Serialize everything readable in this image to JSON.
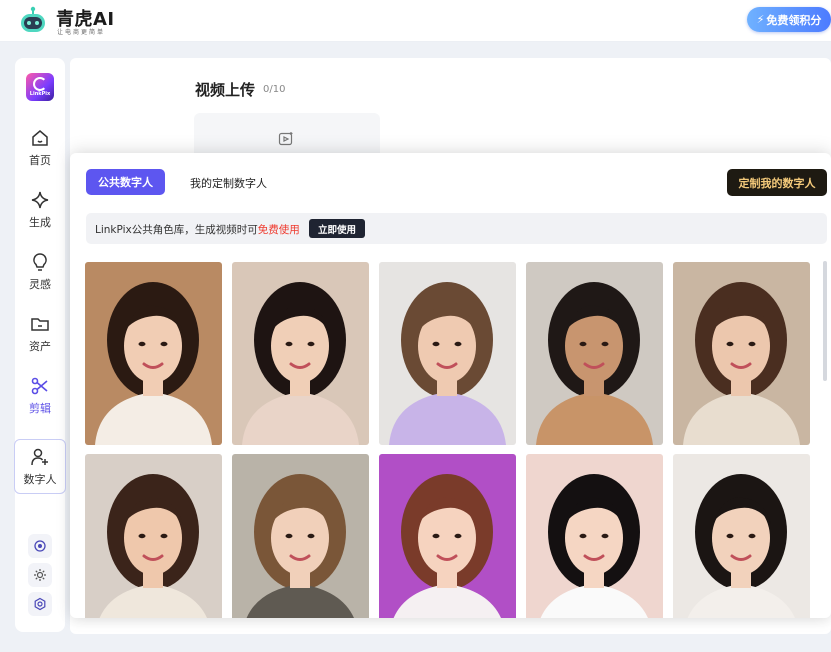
{
  "header": {
    "brand_name": "青虎AI",
    "brand_tagline": "让电商更简单",
    "credits_button": "免费领积分"
  },
  "sidebar": {
    "logo_text": "LinkPix",
    "items": [
      {
        "label": "首页",
        "icon": "home-icon"
      },
      {
        "label": "生成",
        "icon": "sparkle-icon"
      },
      {
        "label": "灵感",
        "icon": "lightbulb-icon"
      },
      {
        "label": "资产",
        "icon": "folder-icon"
      },
      {
        "label": "剪辑",
        "icon": "scissors-icon"
      },
      {
        "label": "数字人",
        "icon": "user-plus-icon"
      }
    ],
    "bottom_buttons": [
      "target-icon",
      "sun-icon",
      "settings-icon"
    ]
  },
  "upload": {
    "title": "视频上传",
    "count": "0/10"
  },
  "panel": {
    "tabs": [
      "公共数字人",
      "我的定制数字人"
    ],
    "active_tab": "公共数字人",
    "custom_button": "定制我的数字人",
    "notice": {
      "text_before": "LinkPix公共角色库，生成视频时可",
      "highlight": "免费使用",
      "button": "立即使用"
    },
    "avatars": [
      {
        "name": "avatar-1",
        "bg": "#b98a63",
        "hair": "#2b1a12",
        "skin": "#f1cdb4",
        "cloth": "#f4ede5"
      },
      {
        "name": "avatar-2",
        "bg": "#d9c7b8",
        "hair": "#1e1412",
        "skin": "#f0cfb7",
        "cloth": "#e9d4c8"
      },
      {
        "name": "avatar-3",
        "bg": "#e6e4e2",
        "hair": "#6a4a34",
        "skin": "#efcab1",
        "cloth": "#c8b4e8"
      },
      {
        "name": "avatar-4",
        "bg": "#cfc9c2",
        "hair": "#1f1816",
        "skin": "#c8956f",
        "cloth": "#c89468"
      },
      {
        "name": "avatar-5",
        "bg": "#c9b6a2",
        "hair": "#4a2e20",
        "skin": "#ecc7ad",
        "cloth": "#e8ddcf"
      },
      {
        "name": "avatar-6",
        "bg": "#d8cfc7",
        "hair": "#3b241a",
        "skin": "#efc8ac",
        "cloth": "#efe7dc"
      },
      {
        "name": "avatar-7",
        "bg": "#b9b3a8",
        "hair": "#7a5638",
        "skin": "#f1d0ba",
        "cloth": "#5f5a52"
      },
      {
        "name": "avatar-8",
        "bg": "#b14fc6",
        "hair": "#7a3b2a",
        "skin": "#f6d3bf",
        "cloth": "#f5f0f2"
      },
      {
        "name": "avatar-9",
        "bg": "#efd6cf",
        "hair": "#141011",
        "skin": "#f5d6c3",
        "cloth": "#fafafa"
      },
      {
        "name": "avatar-10",
        "bg": "#ece8e4",
        "hair": "#1b1513",
        "skin": "#f2d2bc",
        "cloth": "#f3efeb"
      }
    ]
  }
}
